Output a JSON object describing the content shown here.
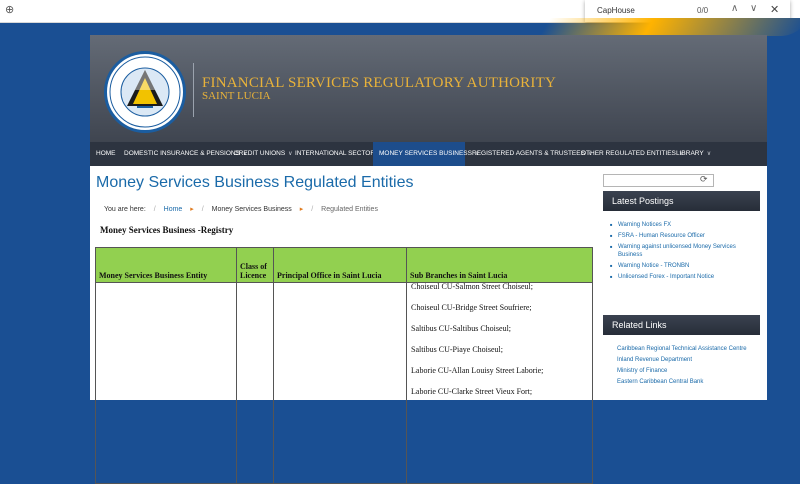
{
  "findbar": {
    "query": "CapHouse",
    "count": "0/0"
  },
  "header": {
    "org_name": "FINANCIAL SERVICES  REGULATORY AUTHORITY",
    "org_sub": "SAINT LUCIA",
    "logo_text_top": "FINANCIAL SERVICES REGULATORY AUTHORITY",
    "logo_text_bottom": "SAINT LUCIA"
  },
  "nav": {
    "items": [
      {
        "label": "HOME",
        "chevron": false
      },
      {
        "label": "DOMESTIC INSURANCE & PENSIONS",
        "chevron": true
      },
      {
        "label": "CREDIT UNIONS",
        "chevron": true
      },
      {
        "label": "INTERNATIONAL SECTOR",
        "chevron": true
      },
      {
        "label": "MONEY SERVICES BUSINESS",
        "chevron": true,
        "active": true
      },
      {
        "label": "REGISTERED AGENTS & TRUSTEES",
        "chevron": true
      },
      {
        "label": "OTHER REGULATED ENTITIES",
        "chevron": true
      },
      {
        "label": "LIBRARY",
        "chevron": true
      }
    ]
  },
  "page": {
    "title": "Money Services Business Regulated Entities",
    "breadcrumb": {
      "prefix": "You are here:",
      "home": "Home",
      "section": "Money Services Business",
      "current": "Regulated Entities"
    },
    "registry_title": "Money Services Business -Registry"
  },
  "table": {
    "headers": [
      "Money Services Business Entity",
      "Class of Licence",
      "Principal Office in Saint Lucia",
      "Sub Branches in Saint Lucia"
    ],
    "branches": [
      "Choiseul CU-Salmon Street Choiseul;",
      "Choiseul CU-Bridge Street Soufriere;",
      "Saltibus CU-Saltibus Choiseul;",
      "Saltibus CU-Piaye Choiseul;",
      "Laborie CU-Allan Louisy Street Laborie;",
      "Laborie CU-Clarke Street Vieux Fort;"
    ]
  },
  "sidebar": {
    "latest_title": "Latest Postings",
    "latest": [
      "Warning Notices FX",
      "FSRA - Human Resource Officer",
      "Warning against unlicensed Money Services Business",
      "Warning Notice - TRONBN",
      "Unlicensed Forex - Important Notice"
    ],
    "related_title": "Related Links",
    "related": [
      "Caribbean Regional Technical Assistance Centre",
      "Inland Revenue Department",
      "Ministry of Finance",
      "Eastern Caribbean Central Bank"
    ]
  },
  "colors": {
    "accent": "#1a6aa9",
    "nav_active": "#1d4d8c",
    "table_header": "#92d050",
    "gold": "#e8b23a"
  }
}
